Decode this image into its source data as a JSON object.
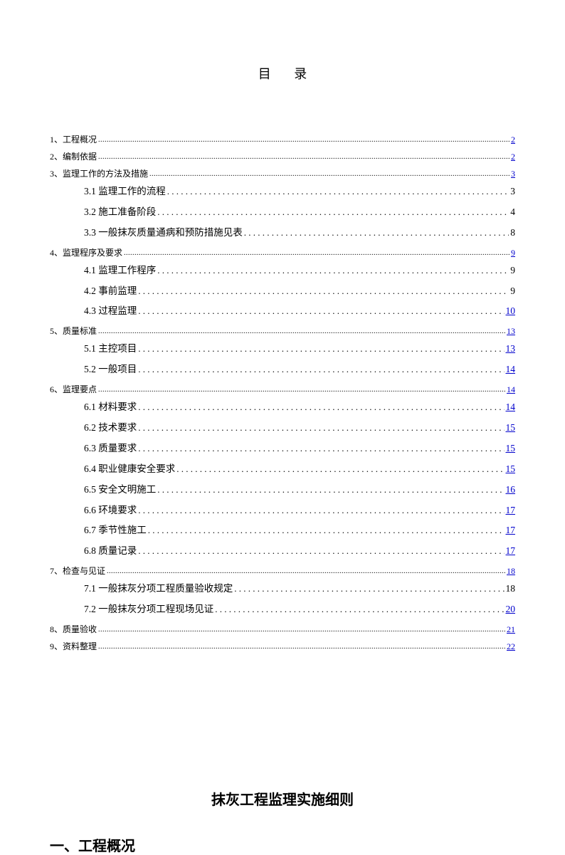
{
  "toc_title": "目 录",
  "entries": [
    {
      "level": 1,
      "label": "1、工程概况",
      "page": "2",
      "linked": true
    },
    {
      "level": 1,
      "label": "2、编制依据",
      "page": "2",
      "linked": true
    },
    {
      "level": 1,
      "label": "3、监理工作的方法及措施",
      "page": "3",
      "linked": true
    },
    {
      "level": 2,
      "label": "3.1 监理工作的流程",
      "page": "3",
      "linked": false
    },
    {
      "level": 2,
      "label": "3.2 施工准备阶段",
      "page": "4",
      "linked": false
    },
    {
      "level": 2,
      "label": "3.3 一般抹灰质量通病和预防措施见表",
      "page": "8",
      "linked": false
    },
    {
      "level": 1,
      "label": "4、监理程序及要求",
      "page": "9",
      "linked": true
    },
    {
      "level": 2,
      "label": "4.1 监理工作程序",
      "page": "9",
      "linked": false
    },
    {
      "level": 2,
      "label": "4.2 事前监理",
      "page": "9",
      "linked": false
    },
    {
      "level": 2,
      "label": "4.3 过程监理",
      "page": "10",
      "linked": true
    },
    {
      "level": 1,
      "label": "5、质量标准",
      "page": "13",
      "linked": true
    },
    {
      "level": 2,
      "label": "5.1 主控项目",
      "page": "13",
      "linked": true
    },
    {
      "level": 2,
      "label": "5.2 一般项目",
      "page": "14",
      "linked": true
    },
    {
      "level": 1,
      "label": "6、监理要点",
      "page": "14",
      "linked": true
    },
    {
      "level": 2,
      "label": "6.1 材料要求",
      "page": "14",
      "linked": true
    },
    {
      "level": 2,
      "label": "6.2 技术要求",
      "page": "15",
      "linked": true
    },
    {
      "level": 2,
      "label": "6.3 质量要求",
      "page": "15",
      "linked": true
    },
    {
      "level": 2,
      "label": "6.4  职业健康安全要求",
      "page": "15",
      "linked": true
    },
    {
      "level": 2,
      "label": "6.5 安全文明施工",
      "page": "16",
      "linked": true
    },
    {
      "level": 2,
      "label": "6.6 环境要求",
      "page": "17",
      "linked": true
    },
    {
      "level": 2,
      "label": "6.7 季节性施工",
      "page": "17",
      "linked": true
    },
    {
      "level": 2,
      "label": "6.8 质量记录",
      "page": "17",
      "linked": true
    },
    {
      "level": 1,
      "label": "7、检查与见证",
      "page": "18",
      "linked": true
    },
    {
      "level": 2,
      "label": "7.1 一般抹灰分项工程质量验收规定",
      "page": "18",
      "linked": false
    },
    {
      "level": 2,
      "label": "7.2 一般抹灰分项工程现场见证",
      "page": "20",
      "linked": true
    },
    {
      "level": 1,
      "label": "8、质量验收",
      "page": "21",
      "linked": true
    },
    {
      "level": 1,
      "label": "9、资料整理",
      "page": "22",
      "linked": true
    }
  ],
  "subtitle": "抹灰工程监理实施细则",
  "section_heading": "一、工程概况"
}
